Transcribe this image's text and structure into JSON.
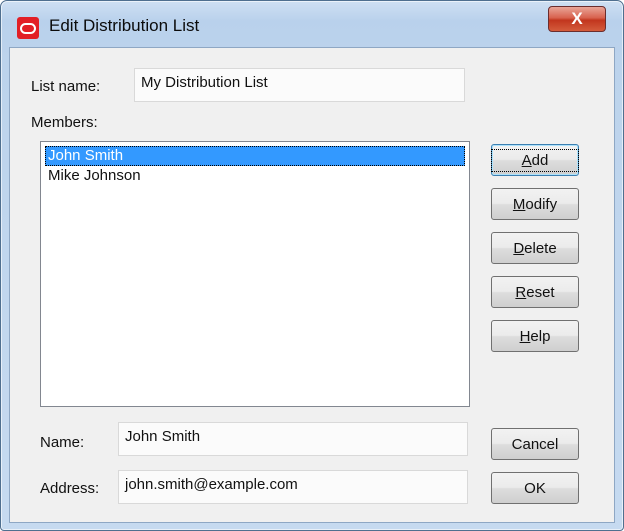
{
  "window": {
    "title": "Edit Distribution List",
    "close_label": "X"
  },
  "form": {
    "list_name_label": "List name:",
    "list_name_value": "My Distribution List",
    "members_label": "Members:",
    "members": [
      {
        "name": "John Smith",
        "selected": true
      },
      {
        "name": "Mike Johnson",
        "selected": false
      }
    ],
    "name_label": "Name:",
    "name_value": "John Smith",
    "address_label": "Address:",
    "address_value": "john.smith@example.com"
  },
  "buttons": {
    "add": {
      "mnemonic": "A",
      "rest": "dd"
    },
    "modify": {
      "mnemonic": "M",
      "rest": "odify"
    },
    "delete": {
      "mnemonic": "D",
      "rest": "elete"
    },
    "reset": {
      "mnemonic": "R",
      "rest": "eset"
    },
    "help": {
      "mnemonic": "H",
      "rest": "elp"
    },
    "cancel": "Cancel",
    "ok": "OK"
  },
  "colors": {
    "selection": "#3399ff",
    "app_icon": "#e21f26"
  },
  "icons": {
    "app": "oracle-logo-icon",
    "close": "close-icon"
  }
}
